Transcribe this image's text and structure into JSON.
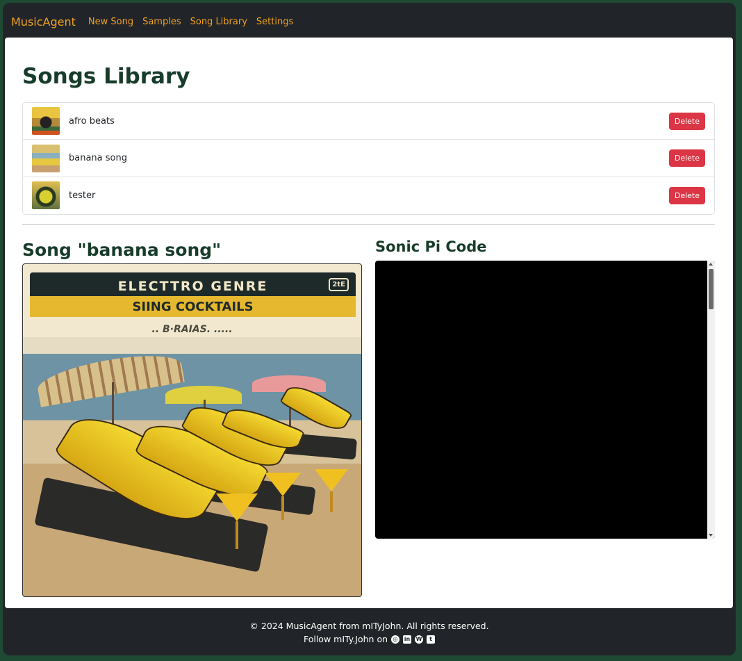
{
  "nav": {
    "brand": "MusicAgent",
    "links": [
      "New Song",
      "Samples",
      "Song Library",
      "Settings"
    ]
  },
  "library": {
    "title": "Songs Library",
    "songs": [
      {
        "name": "afro beats",
        "delete_label": "Delete"
      },
      {
        "name": "banana song",
        "delete_label": "Delete"
      },
      {
        "name": "tester",
        "delete_label": "Delete"
      }
    ]
  },
  "song": {
    "heading": "Song \"banana song\"",
    "cover": {
      "line1": "ELECTTRO GENRE",
      "badge": "2tE",
      "line2": "SIING COCKTAILS",
      "line3": ".. B·RAIAS. ....."
    }
  },
  "code": {
    "heading": "Sonic Pi Code"
  },
  "footer": {
    "copyright": "© 2024 MusicAgent from mITyJohn. All rights reserved.",
    "follow": "Follow mITy.John on",
    "social_icons": [
      "instagram-icon",
      "linkedin-icon",
      "wordpress-icon",
      "twitter-icon"
    ]
  },
  "colors": {
    "accent": "#f0a020",
    "heading": "#183c2b",
    "danger": "#dc3545",
    "background": "#1e4a33"
  }
}
